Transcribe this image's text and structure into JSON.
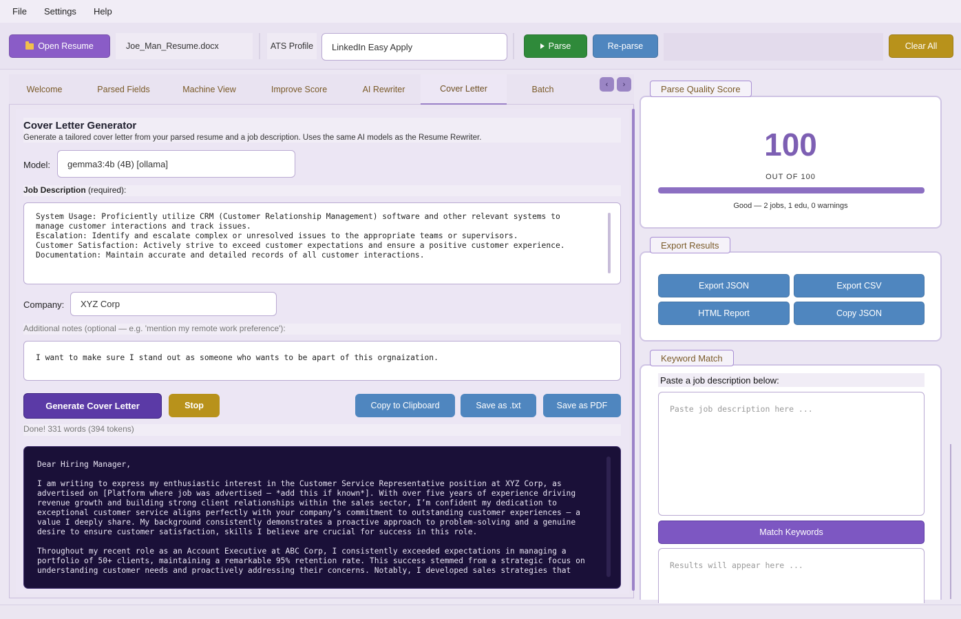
{
  "menu": {
    "file": "File",
    "settings": "Settings",
    "help": "Help"
  },
  "toolbar": {
    "open_label": "Open Resume",
    "filename": "Joe_Man_Resume.docx",
    "ats_label": "ATS Profile",
    "ats_value": "LinkedIn Easy Apply",
    "parse_label": "Parse",
    "reparse_label": "Re-parse",
    "clear_label": "Clear All"
  },
  "tabs": [
    {
      "label": "Welcome"
    },
    {
      "label": "Parsed Fields"
    },
    {
      "label": "Machine View"
    },
    {
      "label": "Improve Score"
    },
    {
      "label": "AI Rewriter"
    },
    {
      "label": "Cover Letter",
      "active": true
    },
    {
      "label": "Batch"
    }
  ],
  "tab_nav": {
    "prev": "‹",
    "next": "›"
  },
  "cover": {
    "title": "Cover Letter Generator",
    "subtitle": "Generate a tailored cover letter from your parsed resume and a job description. Uses the same AI models as the Resume Rewriter.",
    "model_label": "Model:",
    "model_value": "gemma3:4b  (4B)  [ollama]",
    "jd_label": "Job Description",
    "jd_required": " (required):",
    "jd_text": "System Usage: Proficiently utilize CRM (Customer Relationship Management) software and other relevant systems to\nmanage customer interactions and track issues.\nEscalation: Identify and escalate complex or unresolved issues to the appropriate teams or supervisors.\nCustomer Satisfaction: Actively strive to exceed customer expectations and ensure a positive customer experience.\nDocumentation: Maintain accurate and detailed records of all customer interactions.",
    "company_label": "Company:",
    "company_value": "XYZ Corp",
    "notes_label": "Additional notes (optional — e.g. 'mention my remote work preference'):",
    "notes_value": "I want to make sure I stand out as someone who wants to be apart of this orgnaization.",
    "generate_label": "Generate Cover Letter",
    "stop_label": "Stop",
    "copy_label": "Copy to Clipboard",
    "save_txt_label": "Save as .txt",
    "save_pdf_label": "Save as PDF",
    "status": "Done! 331 words (394 tokens)",
    "output": "Dear Hiring Manager,\n\nI am writing to express my enthusiastic interest in the Customer Service Representative position at XYZ Corp, as\nadvertised on [Platform where job was advertised – *add this if known*]. With over five years of experience driving\nrevenue growth and building strong client relationships within the sales sector, I’m confident my dedication to\nexceptional customer service aligns perfectly with your company’s commitment to outstanding customer experiences – a\nvalue I deeply share. My background consistently demonstrates a proactive approach to problem-solving and a genuine\ndesire to ensure customer satisfaction, skills I believe are crucial for success in this role.\n\nThroughout my recent role as an Account Executive at ABC Corp, I consistently exceeded expectations in managing a\nportfolio of 50+ clients, maintaining a remarkable 95% retention rate. This success stemmed from a strategic focus on\nunderstanding customer needs and proactively addressing their concerns. Notably, I developed sales strategies that"
  },
  "quality": {
    "title": "Parse Quality Score",
    "score": "100",
    "out_of": "OUT OF 100",
    "score_fraction": 1.0,
    "rating": "Good",
    "dash": "—",
    "detail": "2 jobs, 1 edu, 0 warnings"
  },
  "export": {
    "title": "Export Results",
    "json": "Export JSON",
    "csv": "Export CSV",
    "html": "HTML Report",
    "copy_json": "Copy JSON"
  },
  "keyword": {
    "title": "Keyword Match",
    "instruction": "Paste a job description below:",
    "placeholder": "Paste job description here ...",
    "match_label": "Match Keywords",
    "results_placeholder": "Results will appear here ..."
  },
  "colors": {
    "accent": "#8a5cc7",
    "parse": "#2f8a3a",
    "blue": "#4f86bf",
    "gold": "#b8921b",
    "output_bg": "#1a1038"
  }
}
